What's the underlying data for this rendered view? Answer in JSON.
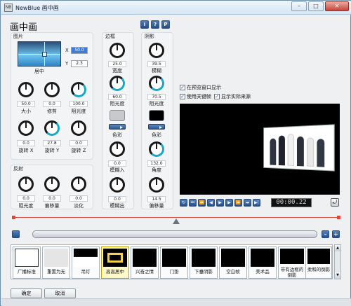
{
  "window": {
    "icon": "NB",
    "title": "NewBlue 画中画",
    "minimize": "–",
    "maximize": "□",
    "close": "✕"
  },
  "main_title": "画中画",
  "top_buttons": [
    "i",
    "?",
    "P"
  ],
  "picture": {
    "heading": "图片",
    "position_label": "居中",
    "x_label": "X",
    "x_value": "50.0",
    "y_label": "Y",
    "y_value": "2.3",
    "knobs": [
      {
        "value": "50.0",
        "label": "大小"
      },
      {
        "value": "0.0",
        "label": "修剪"
      },
      {
        "value": "100.0",
        "label": "阻光度"
      },
      {
        "value": "0.0",
        "label": "旋转 X"
      },
      {
        "value": "27.8",
        "label": "旋转 Y"
      },
      {
        "value": "0.0",
        "label": "旋转 Z"
      }
    ]
  },
  "reflection": {
    "heading": "反射",
    "knobs": [
      {
        "value": "0.0",
        "label": "阻光度"
      },
      {
        "value": "0.0",
        "label": "偏移量"
      },
      {
        "value": "0.0",
        "label": "淡化"
      }
    ]
  },
  "border": {
    "heading": "边框",
    "knobs": [
      {
        "value": "25.0",
        "label": "宽度"
      },
      {
        "value": "60.0",
        "label": "阻光度"
      },
      {
        "value": "0.0",
        "label": "模糊入"
      },
      {
        "value": "0.0",
        "label": "模糊出"
      }
    ],
    "color_label": "色彩",
    "swatch_color": "#c7c9cc"
  },
  "shadow": {
    "heading": "阴影",
    "knobs": [
      {
        "value": "39.5",
        "label": "模糊"
      },
      {
        "value": "70.5",
        "label": "阻光度"
      },
      {
        "value": "132.0",
        "label": "角度"
      },
      {
        "value": "14.5",
        "label": "偏移量"
      }
    ],
    "color_label": "色彩",
    "swatch_color": "#000000"
  },
  "options": [
    {
      "label": "在预览窗口显示",
      "checked": true
    },
    {
      "label": "使用关键帧",
      "checked": true
    },
    {
      "label": "显示实际来源",
      "checked": true
    }
  ],
  "transport": {
    "buttons": [
      "↻",
      "⏮",
      "⏪",
      "◀",
      "▶",
      "▶",
      "⏩",
      "⏭",
      "▶|"
    ],
    "timecode": "00:00.22",
    "reset_icon": "⤾"
  },
  "timeline": {
    "zoom_out": "–",
    "zoom_in": "+",
    "add": "+"
  },
  "presets": [
    "广播标准",
    "重置为无",
    "吊灯",
    "高高居中",
    "兴奋之情",
    "门垫",
    "下垂阴影",
    "空白帧",
    "美术品",
    "带有边框的倒影",
    "柔和的倒影"
  ],
  "footer": {
    "ok": "确定",
    "cancel": "取消"
  }
}
